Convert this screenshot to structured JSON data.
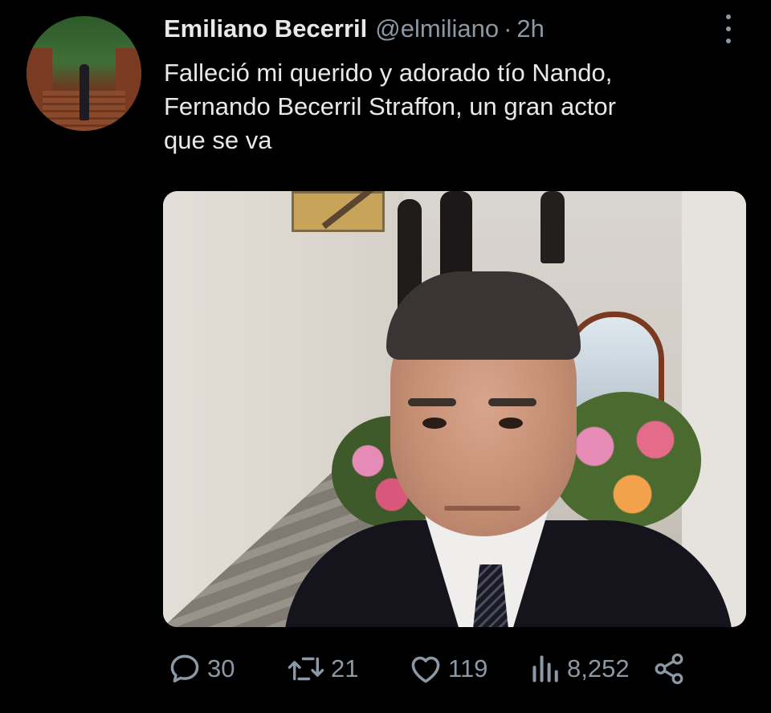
{
  "tweet": {
    "author_name": "Emiliano Becerril",
    "author_handle": "@elmiliano",
    "separator": "·",
    "time": "2h",
    "text": "Falleció mi querido y adorado tío Nando,\nFernando Becerril Straffon, un gran actor\nque se va"
  },
  "actions": {
    "replies": "30",
    "retweets": "21",
    "likes": "119",
    "views": "8,252"
  },
  "icons": {
    "reply": "reply-icon",
    "retweet": "retweet-icon",
    "like": "heart-icon",
    "views": "views-chart-icon",
    "share": "share-icon",
    "more": "more-options-icon"
  },
  "colors": {
    "background": "#000000",
    "primary_text": "#e7e9ea",
    "secondary_text": "#8b98a5"
  }
}
